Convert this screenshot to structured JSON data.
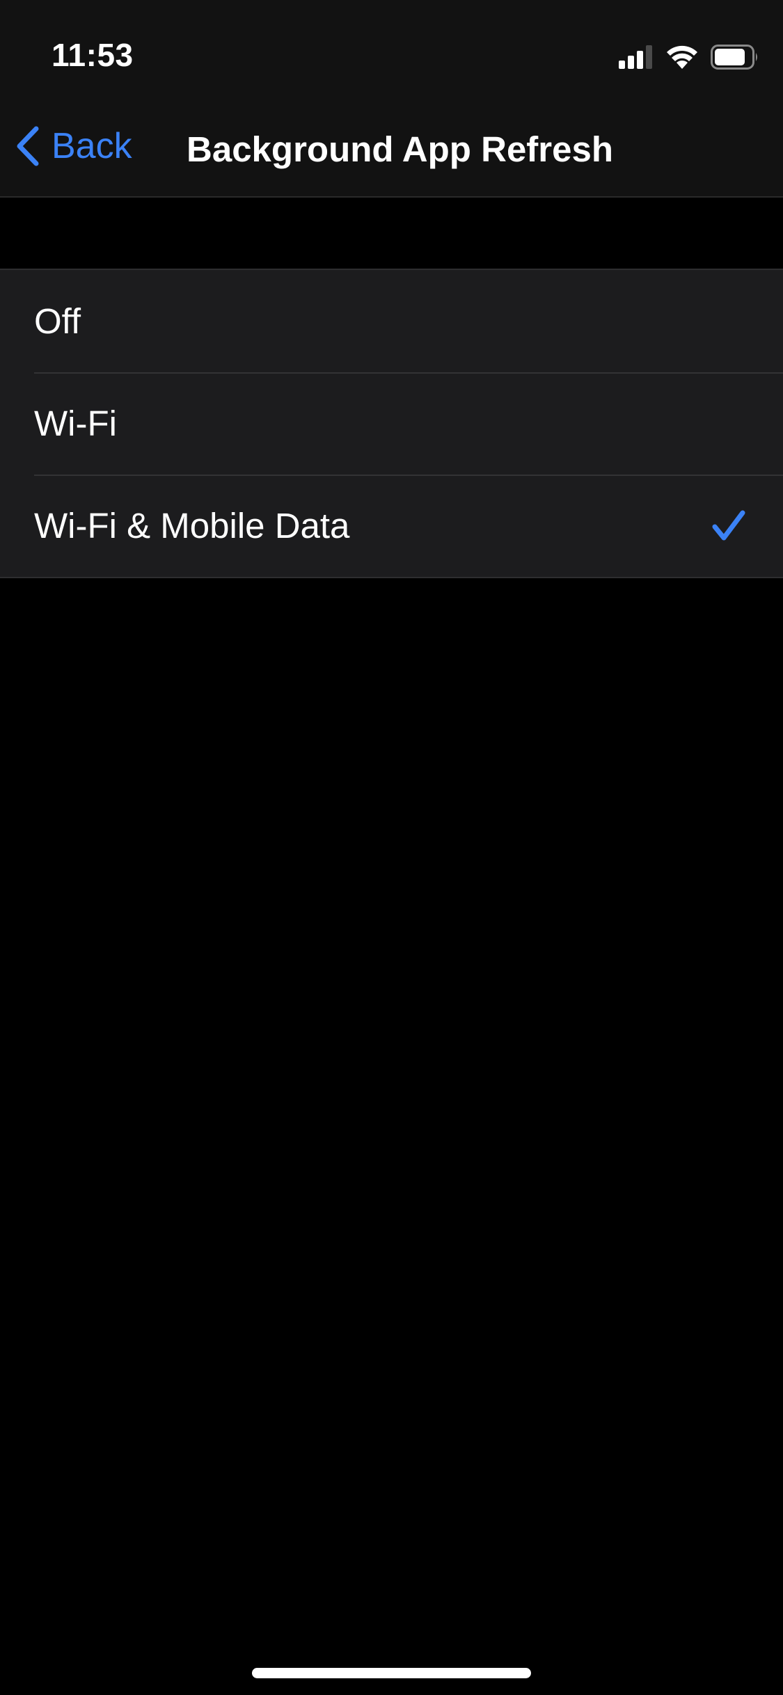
{
  "status_bar": {
    "time": "11:53",
    "signal_bars_filled": 3,
    "signal_bars_total": 4,
    "battery_level_fraction": 0.85,
    "icons": [
      "cellular-signal-icon",
      "wifi-icon",
      "battery-icon"
    ]
  },
  "nav": {
    "back_label": "Back",
    "title": "Background App Refresh"
  },
  "options": [
    {
      "label": "Off",
      "selected": false
    },
    {
      "label": "Wi-Fi",
      "selected": false
    },
    {
      "label": "Wi-Fi & Mobile Data",
      "selected": true
    }
  ],
  "colors": {
    "accent": "#3b82f6",
    "header_bg": "#121212",
    "group_bg": "#1c1c1e",
    "page_bg": "#000000"
  }
}
